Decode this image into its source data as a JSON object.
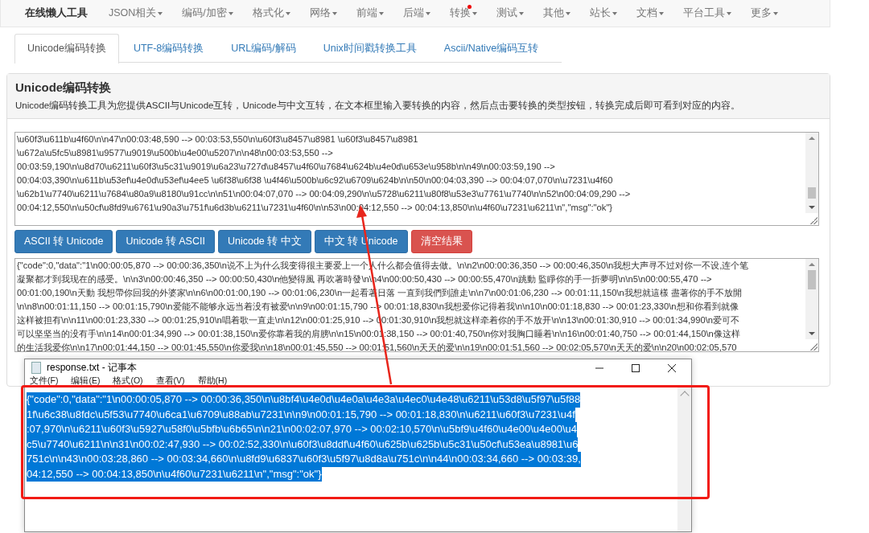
{
  "navbar": {
    "brand": "在线懒人工具",
    "items": [
      {
        "label": "JSON相关",
        "dot": false
      },
      {
        "label": "编码/加密",
        "dot": false
      },
      {
        "label": "格式化",
        "dot": false
      },
      {
        "label": "网络",
        "dot": false
      },
      {
        "label": "前端",
        "dot": false
      },
      {
        "label": "后端",
        "dot": false
      },
      {
        "label": "转换",
        "dot": true
      },
      {
        "label": "测试",
        "dot": false
      },
      {
        "label": "其他",
        "dot": false
      },
      {
        "label": "站长",
        "dot": false
      },
      {
        "label": "文档",
        "dot": false
      },
      {
        "label": "平台工具",
        "dot": false
      },
      {
        "label": "更多",
        "dot": false
      }
    ]
  },
  "tabs": [
    {
      "label": "Unicode编码转换",
      "selected": true
    },
    {
      "label": "UTF-8编码转换",
      "selected": false
    },
    {
      "label": "URL编码/解码",
      "selected": false
    },
    {
      "label": "Unix时间戳转换工具",
      "selected": false
    },
    {
      "label": "Ascii/Native编码互转",
      "selected": false
    }
  ],
  "panel": {
    "title": "Unicode编码转换",
    "description": "Unicode编码转换工具为您提供ASCII与Unicode互转，Unicode与中文互转，在文本框里输入要转换的内容，然后点击要转换的类型按钮，转换完成后即可看到对应的内容。"
  },
  "input_box": {
    "lines": [
      "\\u60f3\\u611b\\u4f60\\n\\n47\\n00:03:48,590 --> 00:03:53,550\\n\\u60f3\\u8457\\u8981 \\u60f3\\u8457\\u8981",
      "\\u672a\\u5fc5\\u8981\\u9577\\u9019\\u500b\\u4e00\\u5207\\n\\n48\\n00:03:53,550 -->",
      "00:03:59,190\\n\\u8d70\\u6211\\u60f3\\u5c31\\u9019\\u6a23\\u727d\\u8457\\u4f60\\u7684\\u624b\\u4e0d\\u653e\\u958b\\n\\n49\\n00:03:59,190 -->",
      "00:04:03,390\\n\\u611b\\u53ef\\u4e0d\\u53ef\\u4ee5 \\u6f38\\u6f38 \\u4f46\\u500b\\u6c92\\u6709\\u624b\\n\\n50\\n00:04:03,390 --> 00:04:07,070\\n\\u7231\\u4f60",
      "\\u62b1\\u7740\\u6211\\u7684\\u80a9\\u8180\\u91cc\\n\\n51\\n00:04:07,070 --> 00:04:09,290\\n\\u5728\\u6211\\u80f8\\u53e3\\u7761\\u7740\\n\\n52\\n00:04:09,290 -->",
      "00:04:12,550\\n\\u50cf\\u8fd9\\u6761\\u90a3\\u751f\\u6d3b\\u6211\\u7231\\u4f60\\n\\n53\\n00:04:12,550 --> 00:04:13,850\\n\\u4f60\\u7231\\u6211\\n\",\"msg\":\"ok\"}"
    ]
  },
  "buttons": [
    {
      "label": "ASCII 转 Unicode",
      "kind": "primary"
    },
    {
      "label": "Unicode 转 ASCII",
      "kind": "primary"
    },
    {
      "label": "Unicode 转 中文",
      "kind": "primary"
    },
    {
      "label": "中文 转 Unicode",
      "kind": "primary"
    },
    {
      "label": "清空结果",
      "kind": "danger"
    }
  ],
  "output_box": {
    "lines": [
      "{\"code\":0,\"data\":\"1\\n00:00:05,870 --> 00:00:36,350\\n说不上为什么我变得很主要爱上一个人什么都会值得去做。\\n\\n2\\n00:00:36,350 --> 00:00:46,350\\n我想大声寻不过对你一不设,连个笔",
      "凝聚都才到我现在的感受。\\n\\n3\\n00:00:46,350 --> 00:00:50,430\\n他變得風 再吹著時發\\n\\n4\\n00:00:50,430 --> 00:00:55,470\\n跳動 監睜你的手一折夢明\\n\\n5\\n00:00:55,470 -->",
      "00:01:00,190\\n天動 我想帶你回我的外婆家\\n\\n6\\n00:01:00,190 --> 00:01:06,230\\n一起看著日落 一直到我們到誰走\\n\\n7\\n00:01:06,230 --> 00:01:11,150\\n我想就這樣 盡著你的手不放開",
      "\\n\\n8\\n00:01:11,150 --> 00:01:15,790\\n爱能不能够永远当着没有被爱\\n\\n9\\n00:01:15,790 --> 00:01:18,830\\n我想爱你记得着我\\n\\n10\\n00:01:18,830 --> 00:01:23,330\\n想和你看到就像",
      "这样被担有\\n\\n11\\n00:01:23,330 --> 00:01:25,910\\n唱着歌一直走\\n\\n12\\n00:01:25,910 --> 00:01:30,910\\n我想就这样牵着你的手不放开\\n\\n13\\n00:01:30,910 --> 00:01:34,990\\n爱可不",
      "可以坚坚当的没有手\\n\\n14\\n00:01:34,990 --> 00:01:38,150\\n爱你靠着我的肩膀\\n\\n15\\n00:01:38,150 --> 00:01:40,750\\n你对我胸口睡着\\n\\n16\\n00:01:40,750 --> 00:01:44,150\\n像这样",
      "的生活我爱你\\n\\n17\\n00:01:44,150 --> 00:01:45,550\\n你爱我\\n\\n18\\n00:01:45,550 --> 00:01:51,560\\n天天的爱\\n\\n19\\n00:01:51,560 --> 00:02:05,570\\n天天的爱\\n\\n20\\n00:02:05,570"
    ]
  },
  "notepad": {
    "title": "response.txt - 记事本",
    "menu": [
      "文件(F)",
      "编辑(E)",
      "格式(O)",
      "查看(V)",
      "帮助(H)"
    ],
    "selected": true,
    "lines": [
      "{\"code\":0,\"data\":\"1\\n00:00:05,870 --> 00:00:36,350\\n\\u8bf4\\u4e0d\\u4e0a\\u4e3a\\u4ec0\\u4e48\\u6211\\u53d8\\u5f97\\u5f88",
      "1f\\u6c38\\u8fdc\\u5f53\\u7740\\u6ca1\\u6709\\u88ab\\u7231\\n\\n9\\n00:01:15,790 --> 00:01:18,830\\n\\u6211\\u60f3\\u7231\\u4f",
      ":07,970\\n\\u6211\\u60f3\\u5927\\u58f0\\u5bfb\\u6b65\\n\\n21\\n00:02:07,970 --> 00:02:10,570\\n\\u5bf9\\u4f60\\u4e00\\u4e00\\u4",
      "c5\\u7740\\u6211\\n\\n31\\n00:02:47,930 --> 00:02:52,330\\n\\u60f3\\u8ddf\\u4f60\\u625b\\u625b\\u5c31\\u50cf\\u53ea\\u8981\\u6",
      "751c\\n\\n43\\n00:03:28,860 --> 00:03:34,660\\n\\u8fd9\\u6837\\u60f3\\u5f97\\u8d8a\\u751c\\n\\n44\\n00:03:34,660 --> 00:03:39,",
      "04:12,550 --> 00:04:13,850\\n\\u4f60\\u7231\\u6211\\n\",\"msg\":\"ok\"}"
    ]
  }
}
